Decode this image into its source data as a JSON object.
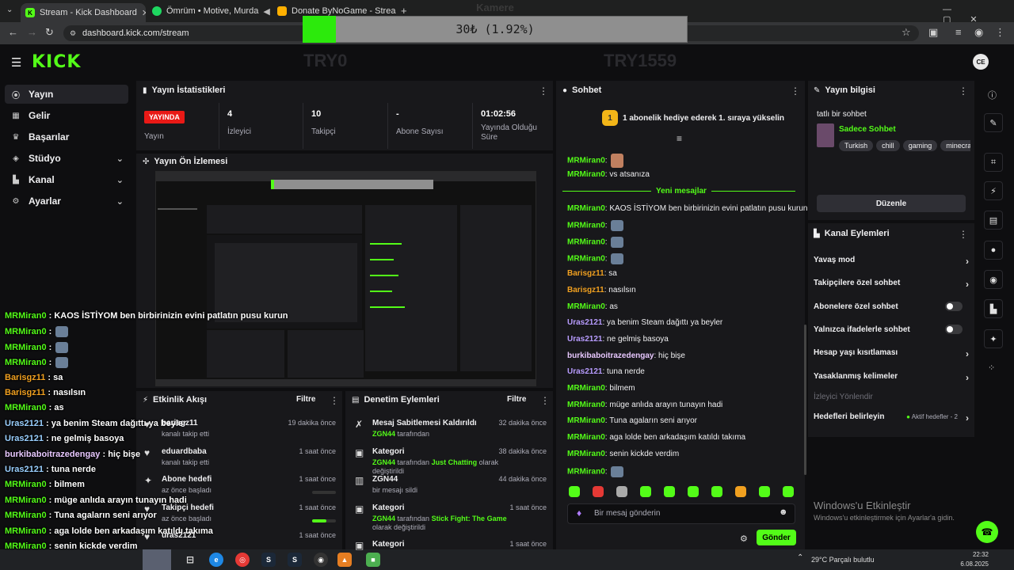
{
  "browser": {
    "tabs": [
      {
        "title": "Stream - Kick Dashboard",
        "favicon": "kick-icon"
      },
      {
        "title": "Ömrüm • Motive, Murda",
        "favicon": "spotify-icon"
      },
      {
        "title": "Donate ByNoGame - Streamer",
        "favicon": "bynogame-icon"
      }
    ],
    "url": "dashboard.kick.com/stream"
  },
  "overlay": {
    "camera_label": "Kamere",
    "goal_text": "30₺ (1.92%)",
    "goal_progress_pct": 1.92,
    "left_name": "TRY0",
    "right_name": "TRY1559"
  },
  "header": {
    "logo": "KICK",
    "avatar_initials": "CE"
  },
  "sidebar": {
    "items": [
      {
        "label": "Yayın",
        "icon": "broadcast-icon",
        "active": true,
        "expandable": false
      },
      {
        "label": "Gelir",
        "icon": "revenue-icon",
        "active": false,
        "expandable": false
      },
      {
        "label": "Başarılar",
        "icon": "trophy-icon",
        "active": false,
        "expandable": false
      },
      {
        "label": "Stüdyo",
        "icon": "studio-icon",
        "active": false,
        "expandable": true
      },
      {
        "label": "Kanal",
        "icon": "channel-icon",
        "active": false,
        "expandable": true
      },
      {
        "label": "Ayarlar",
        "icon": "gear-icon",
        "active": false,
        "expandable": true
      }
    ]
  },
  "stats": {
    "title": "Yayın İstatistikleri",
    "live_badge": "YAYINDA",
    "live_label": "Yayın",
    "items": [
      {
        "value": "4",
        "label": "İzleyici"
      },
      {
        "value": "10",
        "label": "Takipçi"
      },
      {
        "value": "-",
        "label": "Abone Sayısı"
      },
      {
        "value": "01:02:56",
        "label": "Yayında Olduğu Süre"
      }
    ]
  },
  "preview": {
    "title": "Yayın Ön İzlemesi"
  },
  "activity": {
    "title": "Etkinlik Akışı",
    "filter": "Filtre",
    "items": [
      {
        "title": "barisgz11",
        "sub": "kanalı takip etti",
        "time": "19 dakika önce"
      },
      {
        "title": "eduardbaba",
        "sub": "kanalı takip etti",
        "time": "1 saat önce"
      },
      {
        "title": "Abone hedefi",
        "sub": "az önce başladı",
        "time": "1 saat önce"
      },
      {
        "title": "Takipçi hedefi",
        "sub": "az önce başladı",
        "time": "1 saat önce"
      },
      {
        "title": "uras2121",
        "sub": "",
        "time": "1 saat önce"
      }
    ]
  },
  "moderation": {
    "title": "Denetim Eylemleri",
    "filter": "Filtre",
    "items": [
      {
        "title": "Mesaj Sabitlemesi Kaldırıldı",
        "actor": "ZGN44",
        "mid": " tarafından",
        "highlight": "",
        "tail": "",
        "time": "32 dakika önce"
      },
      {
        "title": "Kategori",
        "actor": "ZGN44",
        "mid": " tarafından ",
        "highlight": "Just Chatting",
        "tail": " olarak değiştirildi",
        "time": "38 dakika önce"
      },
      {
        "title": "ZGN44",
        "actor": "",
        "mid": "bir mesajı sildi",
        "highlight": "",
        "tail": "",
        "time": "44 dakika önce"
      },
      {
        "title": "Kategori",
        "actor": "ZGN44",
        "mid": " tarafından ",
        "highlight": "Stick Fight: The Game",
        "tail": " olarak değiştirildi",
        "time": "1 saat önce"
      },
      {
        "title": "Kategori",
        "actor": "",
        "mid": "",
        "highlight": "",
        "tail": "",
        "time": "1 saat önce"
      }
    ]
  },
  "chat": {
    "title": "Sohbet",
    "gift_banner": "1 abonelik hediye ederek 1. sıraya yükselin",
    "gift_rank": "1",
    "new_messages": "Yeni mesajlar",
    "input_placeholder": "Bir mesaj gönderin",
    "send_label": "Gönder",
    "messages": [
      {
        "user": "MRMiran0",
        "text": "",
        "emote": true,
        "cls": "u-mr"
      },
      {
        "user": "MRMiran0",
        "text": "vs atsanıza",
        "emote": false,
        "cls": "u-mr"
      },
      {
        "user": "MRMiran0",
        "text": "KAOS İSTİYOM ben birbirinizin evini patlatın pusu kurun",
        "emote": false,
        "cls": "u-mr"
      },
      {
        "user": "MRMiran0",
        "text": "",
        "emote": true,
        "cls": "u-mr"
      },
      {
        "user": "MRMiran0",
        "text": "",
        "emote": true,
        "cls": "u-mr"
      },
      {
        "user": "MRMiran0",
        "text": "",
        "emote": true,
        "cls": "u-mr"
      },
      {
        "user": "Barisgz11",
        "text": "sa",
        "emote": false,
        "cls": "u-bar"
      },
      {
        "user": "Barisgz11",
        "text": "nasılsın",
        "emote": false,
        "cls": "u-bar"
      },
      {
        "user": "MRMiran0",
        "text": "as",
        "emote": false,
        "cls": "u-mr"
      },
      {
        "user": "Uras2121",
        "text": "ya benim Steam dağıttı ya beyler",
        "emote": false,
        "cls": "u-uras"
      },
      {
        "user": "Uras2121",
        "text": "ne gelmiş basoya",
        "emote": false,
        "cls": "u-uras"
      },
      {
        "user": "burkibaboitrazedengay",
        "text": "hiç bişe",
        "emote": false,
        "cls": "u-burk"
      },
      {
        "user": "Uras2121",
        "text": "tuna nerde",
        "emote": false,
        "cls": "u-uras"
      },
      {
        "user": "MRMiran0",
        "text": "bilmem",
        "emote": false,
        "cls": "u-mr"
      },
      {
        "user": "MRMiran0",
        "text": "müge anlıda arayın tunayın hadi",
        "emote": false,
        "cls": "u-mr"
      },
      {
        "user": "MRMiran0",
        "text": "Tuna agaların seni arıyor",
        "emote": false,
        "cls": "u-mr"
      },
      {
        "user": "MRMiran0",
        "text": "aga lolde ben arkadaşım katıldı takıma",
        "emote": false,
        "cls": "u-mr"
      },
      {
        "user": "MRMiran0",
        "text": "senin kickde verdim",
        "emote": false,
        "cls": "u-mr"
      },
      {
        "user": "MRMiran0",
        "text": "",
        "emote": true,
        "cls": "u-mr"
      }
    ]
  },
  "overlay_chat": [
    {
      "user": "MRMiran0",
      "text": "KAOS İSTİYOM ben birbirinizin evini patlatın pusu kurun",
      "cls": "u-mr"
    },
    {
      "user": "MRMiran0",
      "text": "",
      "cls": "u-mr"
    },
    {
      "user": "MRMiran0",
      "text": "",
      "cls": "u-mr"
    },
    {
      "user": "MRMiran0",
      "text": "",
      "cls": "u-mr"
    },
    {
      "user": "Barisgz11",
      "text": "sa",
      "cls": "u-bar"
    },
    {
      "user": "Barisgz11",
      "text": "nasılsın",
      "cls": "u-bar"
    },
    {
      "user": "MRMiran0",
      "text": "as",
      "cls": "u-mr"
    },
    {
      "user": "Uras2121",
      "text": "ya benim Steam dağıttı ya beyler",
      "cls": "u-uras"
    },
    {
      "user": "Uras2121",
      "text": "ne gelmiş basoya",
      "cls": "u-uras"
    },
    {
      "user": "burkibaboitrazedengay",
      "text": "hiç bişe",
      "cls": "u-burk"
    },
    {
      "user": "Uras2121",
      "text": "tuna nerde",
      "cls": "u-uras"
    },
    {
      "user": "MRMiran0",
      "text": "bilmem",
      "cls": "u-mr"
    },
    {
      "user": "MRMiran0",
      "text": "müge anlıda arayın tunayın hadi",
      "cls": "u-mr"
    },
    {
      "user": "MRMiran0",
      "text": "Tuna agaların seni arıyor",
      "cls": "u-mr"
    },
    {
      "user": "MRMiran0",
      "text": "aga lolde ben arkadaşım katıldı takıma",
      "cls": "u-mr"
    },
    {
      "user": "MRMiran0",
      "text": "senin kickde verdim",
      "cls": "u-mr"
    }
  ],
  "stream_info": {
    "title": "Yayın bilgisi",
    "stream_title": "tatlı bir sohbet",
    "category": "Sadece Sohbet",
    "tags": [
      "Turkish",
      "chill",
      "gaming",
      "minecraf"
    ],
    "edit_button": "Düzenle"
  },
  "channel_actions": {
    "title": "Kanal Eylemleri",
    "items": [
      {
        "label": "Yavaş mod",
        "kind": "arrow"
      },
      {
        "label": "Takipçilere özel sohbet",
        "kind": "arrow"
      },
      {
        "label": "Abonelere özel sohbet",
        "kind": "toggle"
      },
      {
        "label": "Yalnızca ifadelerle sohbet",
        "kind": "toggle"
      },
      {
        "label": "Hesap yaşı kısıtlaması",
        "kind": "arrow"
      },
      {
        "label": "Yasaklanmış kelimeler",
        "kind": "arrow"
      }
    ],
    "viewer_direct": "İzleyici Yönlendir",
    "goals_label": "Hedefleri belirleyin",
    "goals_status": "Aktif hedefler - 2"
  },
  "windows_activation": {
    "title": "Windows'u Etkinleştir",
    "sub": "Windows'u etkinleştirmek için Ayarlar'a gidin."
  },
  "taskbar": {
    "weather": "29°C Parçalı bulutlu",
    "time": "22:32",
    "date": "6.08.2025"
  },
  "colors": {
    "accent": "#53fc18",
    "live": "#e91916",
    "panel": "#18181b",
    "bg": "#0e0e10"
  }
}
